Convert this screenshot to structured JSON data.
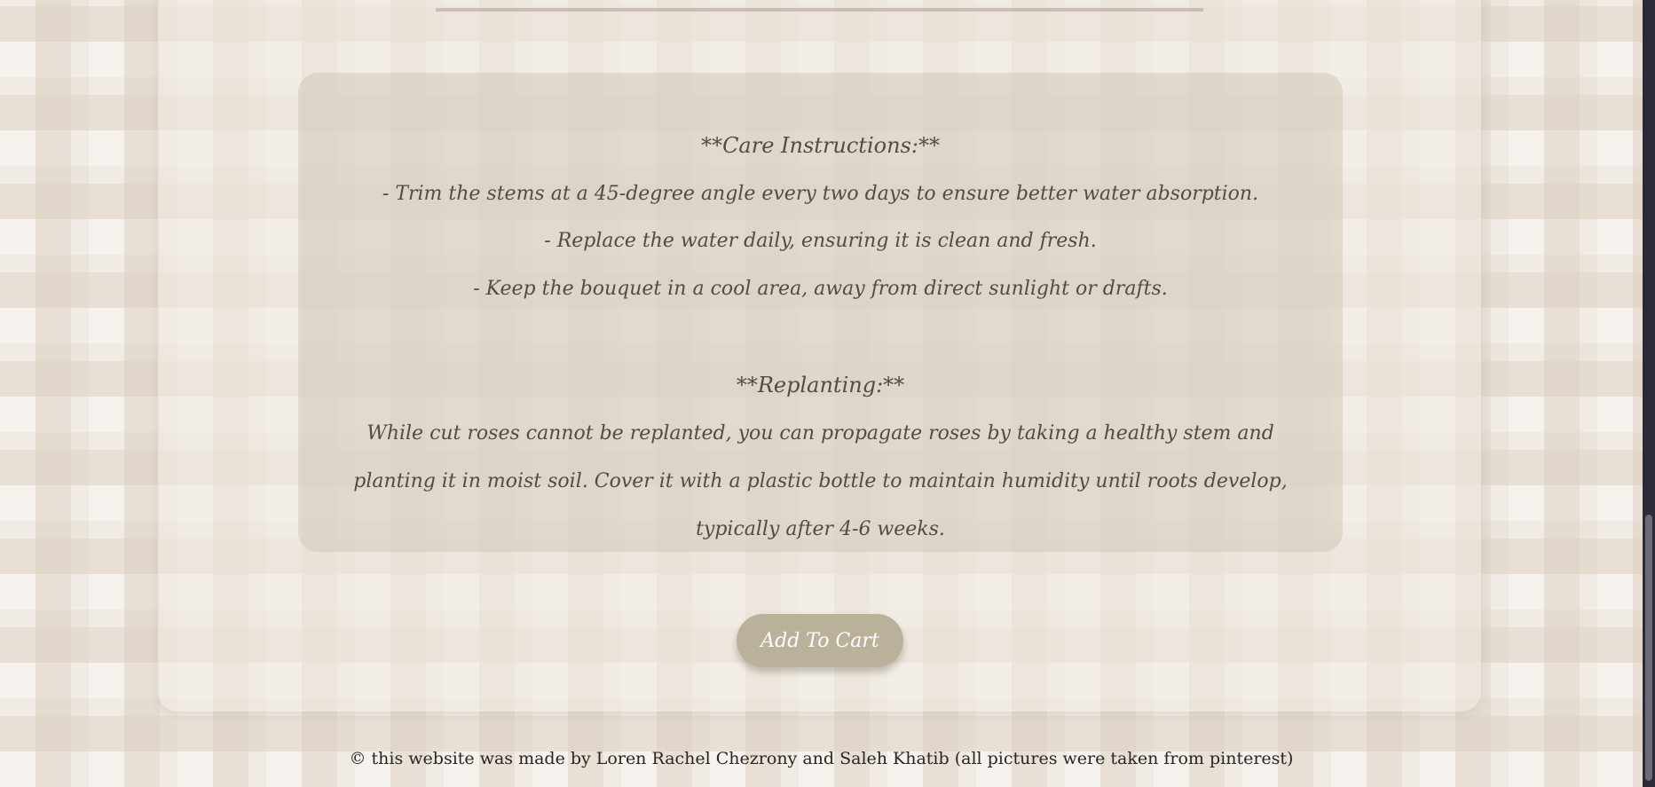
{
  "care": {
    "title": "**Care Instructions:**",
    "item1": "- Trim the stems at a 45-degree angle every two days to ensure better water absorption.",
    "item2": "- Replace the water daily, ensuring it is clean and fresh.",
    "item3": "- Keep the bouquet in a cool area, away from direct sunlight or drafts."
  },
  "replanting": {
    "title": "**Replanting:**",
    "text": "While cut roses cannot be replanted, you can propagate roses by taking a healthy stem and planting it in moist soil. Cover it with a plastic bottle to maintain humidity until roots develop, typically after 4-6 weeks."
  },
  "actions": {
    "add_to_cart": "Add To Cart"
  },
  "footer": {
    "credit": "© this website was made by Loren Rachel Chezrony and Saleh Khatib (all pictures were taken from pinterest)"
  },
  "colors": {
    "button_bg": "#b9b19a",
    "text": "#514c47",
    "scrollbar": "#2a2b36"
  }
}
